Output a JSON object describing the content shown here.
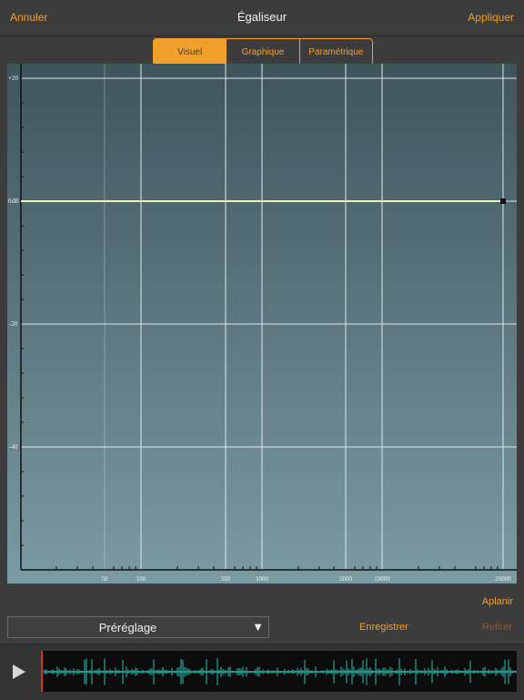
{
  "header": {
    "cancel_label": "Annuler",
    "title": "Égaliseur",
    "apply_label": "Appliquer"
  },
  "tabs": [
    {
      "label": "Visuel",
      "active": true
    },
    {
      "label": "Graphique",
      "active": false
    },
    {
      "label": "Paramétrique",
      "active": false
    }
  ],
  "graph": {
    "y_ticks": [
      "+20",
      "0dB",
      "-20",
      "-40"
    ],
    "x_ticks": [
      "50",
      "100",
      "500",
      "1000",
      "5000",
      "10000",
      "20000"
    ],
    "curve_level_db": 0,
    "curve_color": "#f0f0c0"
  },
  "controls": {
    "flatten_label": "Aplanir",
    "preset_label": "Préréglage",
    "save_label": "Enregistrer",
    "remove_label": "Retirer"
  },
  "player": {
    "play_icon": "play-icon",
    "waveform_color": "#2ec2b0",
    "playhead_color": "#d03030"
  },
  "colors": {
    "accent": "#f2a02c",
    "disabled": "#8a5a3a"
  }
}
